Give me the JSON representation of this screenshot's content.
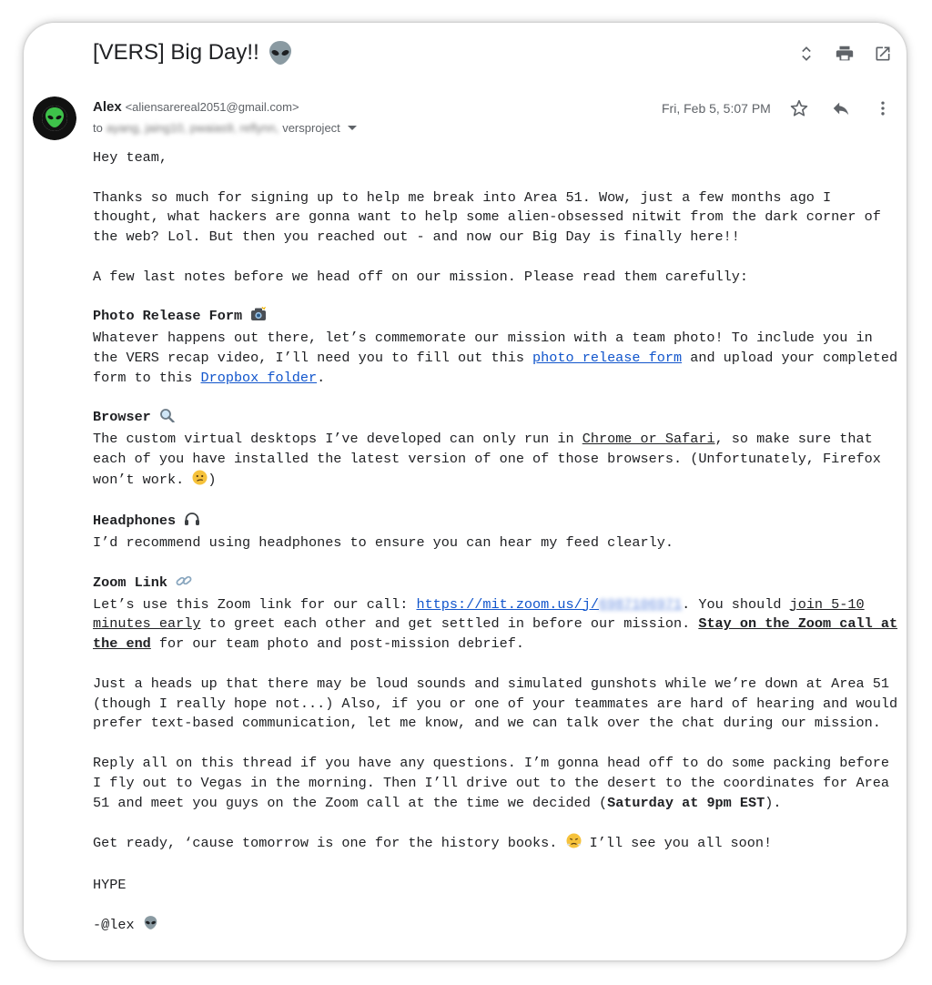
{
  "subject": "[VERS] Big Day!!",
  "colors": {
    "link": "#1155cc",
    "text": "#202124",
    "muted": "#5f6368",
    "avatar_green": "#3ec24a"
  },
  "icons": {
    "subject_emoji": "alien-icon",
    "expand": "unfold-icon",
    "print": "print-icon",
    "popout": "open-in-new-icon",
    "star": "star-icon",
    "reply": "reply-icon",
    "more": "more-vert-icon"
  },
  "sender": {
    "name": "Alex",
    "email": "<aliensarereal2051@gmail.com>"
  },
  "recipients": {
    "prefix": "to",
    "blurred": "ayang, jaing10, pwaias9, reflynn,",
    "visible": "versproject"
  },
  "date": "Fri, Feb 5, 5:07 PM",
  "body": {
    "greeting": "Hey team,",
    "p1": "Thanks so much for signing up to help me break into Area 51. Wow, just a few months ago I thought, what hackers are gonna want to help some alien-obsessed nitwit from the dark corner of the web? Lol. But then you reached out - and now our Big Day is finally here!!",
    "p2": "A few last notes before we head off on our mission. Please read them carefully:",
    "photo": {
      "heading": "Photo Release Form",
      "t1": "Whatever happens out there, let’s commemorate our mission with a team photo! To include you in the VERS recap video, I’ll need you to fill out this ",
      "link1": "photo release form",
      "t2": " and upload your completed form to this ",
      "link2": "Dropbox folder",
      "t3": "."
    },
    "browser": {
      "heading": "Browser",
      "t1": "The custom virtual desktops I’ve developed can only run in ",
      "u1": "Chrome or Safari",
      "t2": ", so make sure that each of you have installed the latest version of one of those browsers. (Unfortunately, Firefox won’t work. ",
      "t3": ")"
    },
    "headphones": {
      "heading": "Headphones",
      "t1": "I’d recommend using headphones to ensure you can hear my feed clearly."
    },
    "zoom": {
      "heading": "Zoom Link",
      "t1": "Let’s use this Zoom link for our call: ",
      "link": "https://mit.zoom.us/j/",
      "link_blurred": "6987106971",
      "t2": ". You should ",
      "u1": "join 5-10 minutes early",
      "t3": " to greet each other and get settled in before our mission. ",
      "bu1": "Stay on the Zoom call at the end",
      "t4": " for our team photo and post-mission debrief."
    },
    "p3": "Just a heads up that there may be loud sounds and simulated gunshots while we’re down at Area 51 (though I really hope not...) Also, if you or one of your teammates are hard of hearing and would prefer text-based communication, let me know, and we can talk over the chat during our mission.",
    "p4": {
      "t1": "Reply all on this thread if you have any questions. I’m gonna head off to do some packing before I fly out to Vegas in the morning. Then I’ll drive out to the desert to the coordinates for Area 51 and meet you guys on the Zoom call at the time we decided (",
      "b1": "Saturday at 9pm EST",
      "t2": ")."
    },
    "p5": {
      "t1": "Get ready, ‘cause tomorrow is one for the history books. ",
      "t2": " I’ll see you all soon!"
    },
    "hype": "HYPE",
    "sign": "-@lex "
  }
}
